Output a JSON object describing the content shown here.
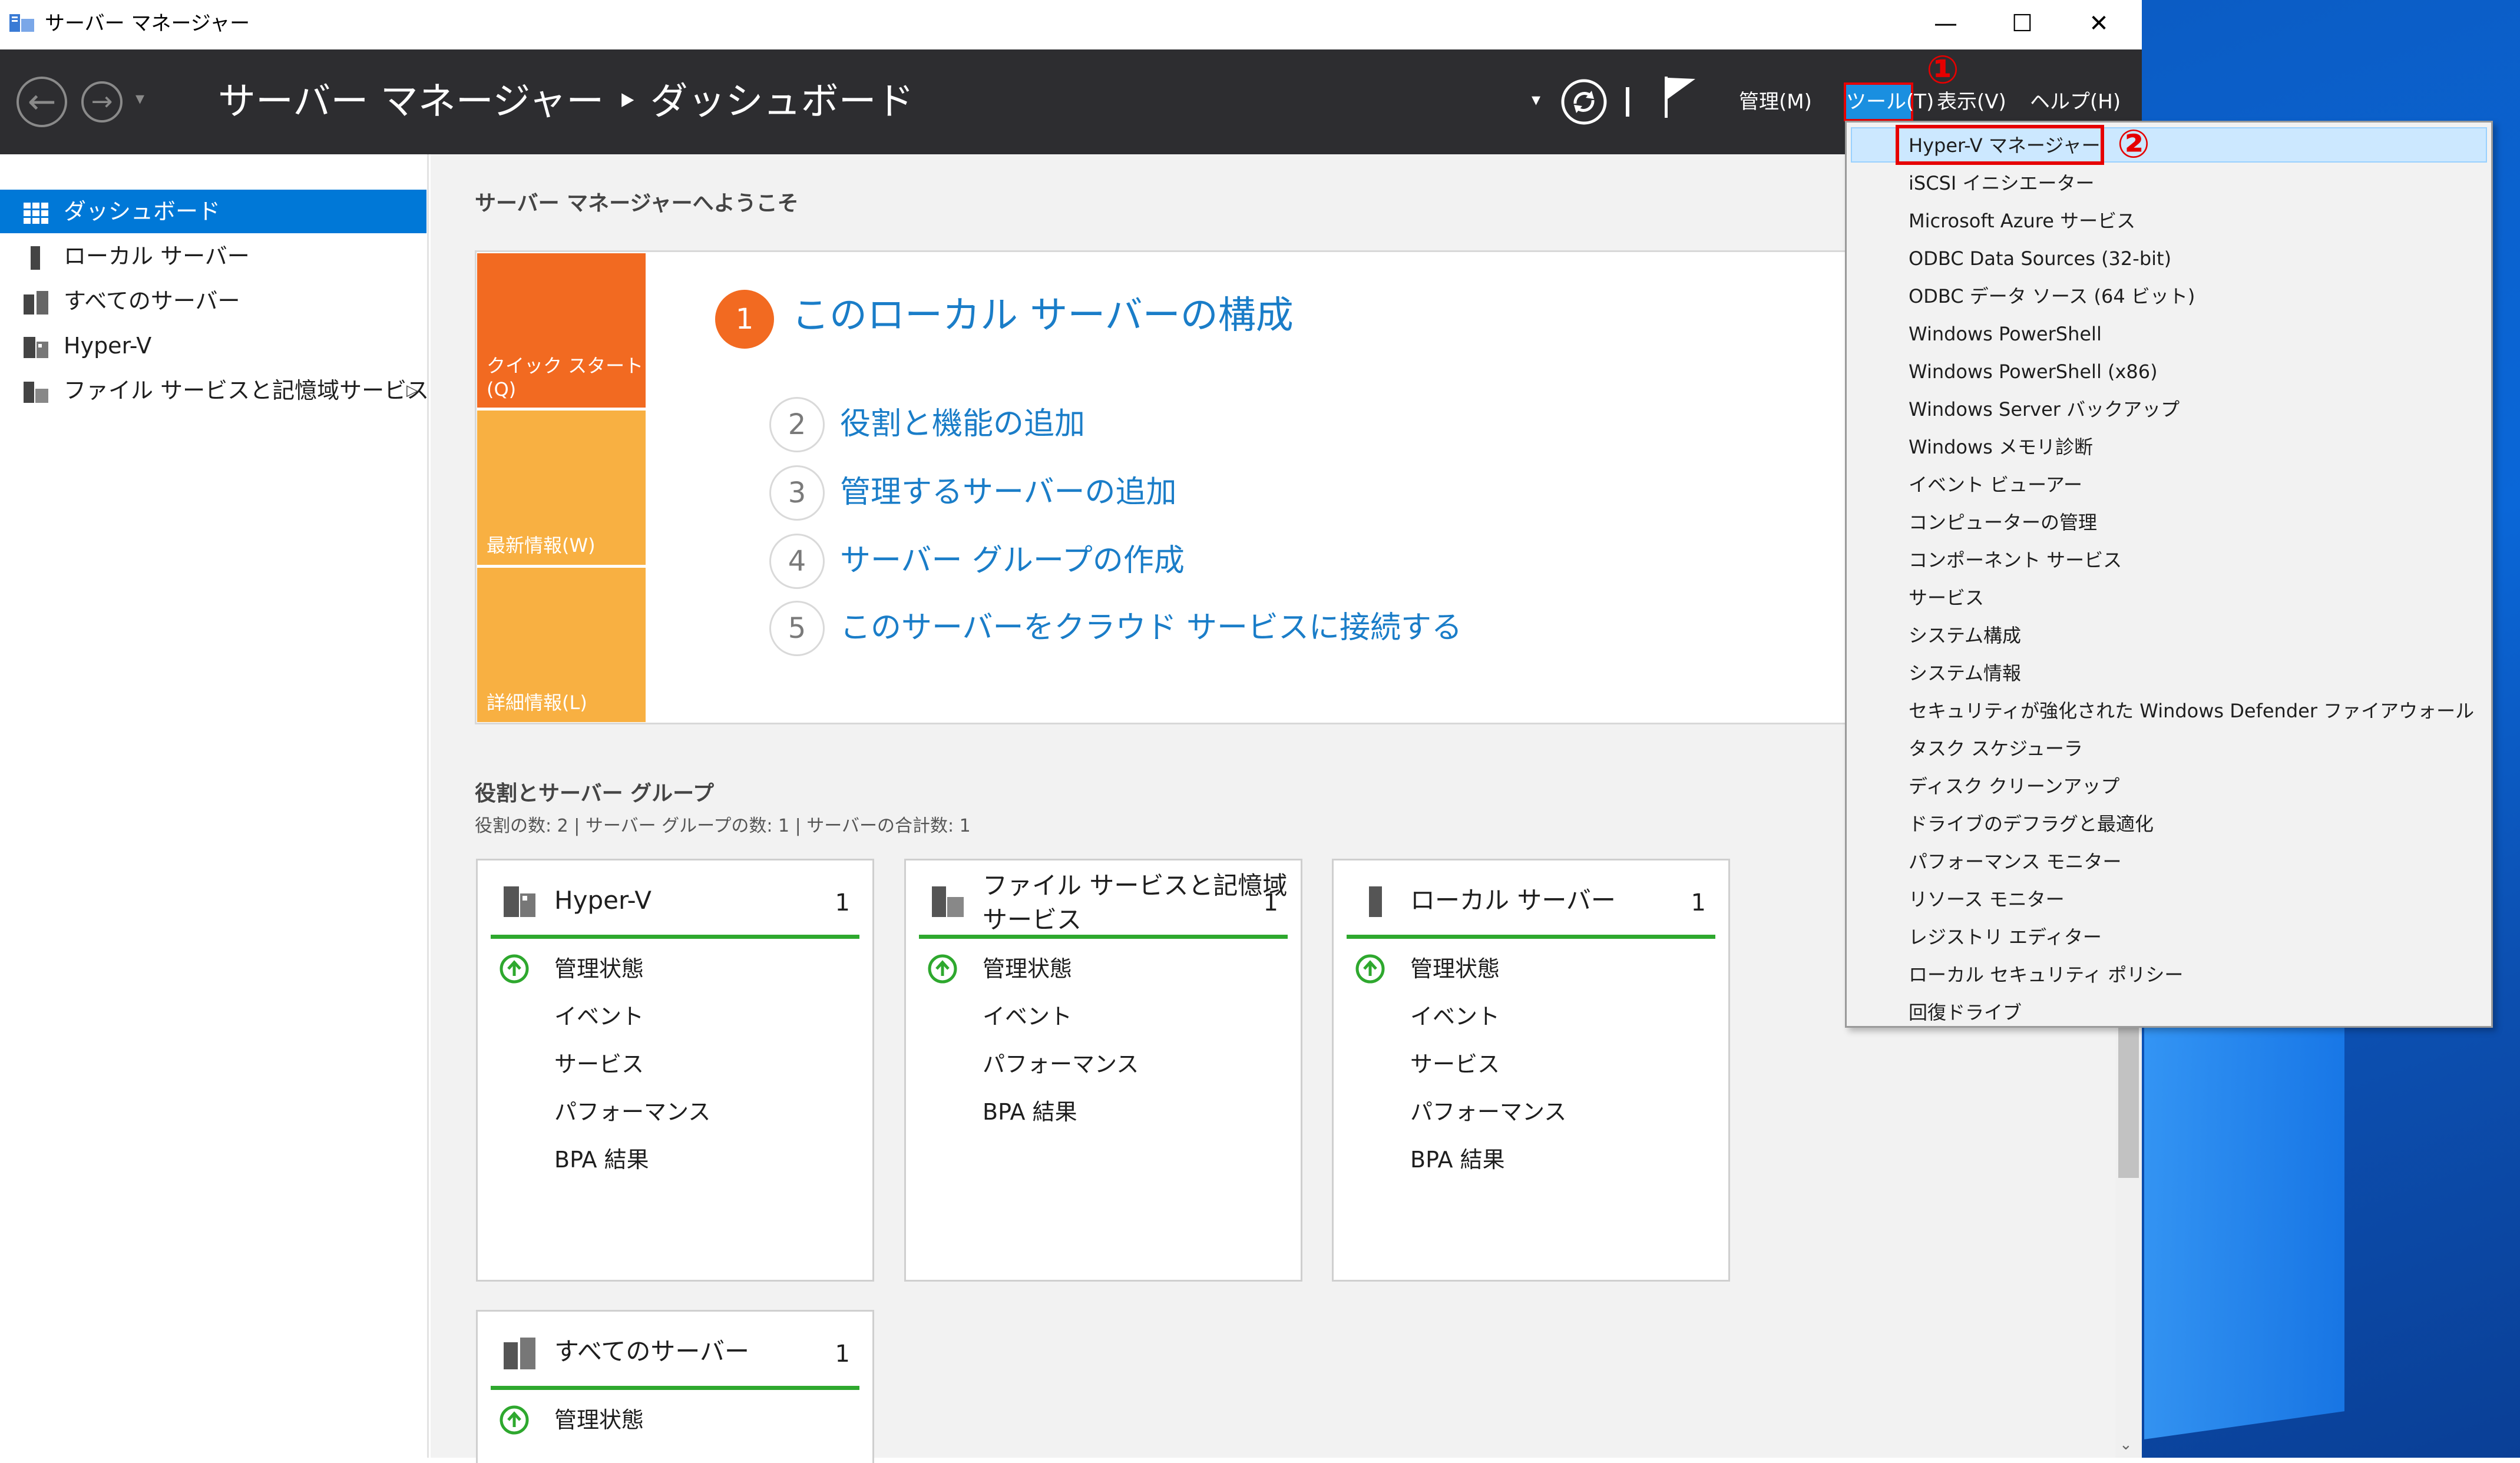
{
  "window": {
    "title": "サーバー マネージャー",
    "controls": [
      "—",
      "☐",
      "✕"
    ]
  },
  "header": {
    "breadcrumb": "サーバー マネージャー ‣ ダッシュボード",
    "menus": {
      "manage": "管理(M)",
      "tools": "ツール(T)",
      "view": "表示(V)",
      "help": "ヘルプ(H)"
    },
    "annotation1": "①",
    "annotation2": "②"
  },
  "sidebar": {
    "items": [
      {
        "label": "ダッシュボード",
        "active": true
      },
      {
        "label": "ローカル サーバー"
      },
      {
        "label": "すべてのサーバー"
      },
      {
        "label": "Hyper-V"
      },
      {
        "label": "ファイル サービスと記憶域サービス"
      }
    ]
  },
  "main": {
    "welcome": "サーバー マネージャーへようこそ",
    "tiles": [
      "クイック スタート(Q)",
      "最新情報(W)",
      "詳細情報(L)"
    ],
    "steps": [
      {
        "num": "1",
        "label": "このローカル サーバーの構成"
      },
      {
        "num": "2",
        "label": "役割と機能の追加"
      },
      {
        "num": "3",
        "label": "管理するサーバーの追加"
      },
      {
        "num": "4",
        "label": "サーバー グループの作成"
      },
      {
        "num": "5",
        "label": "このサーバーをクラウド サービスに接続する"
      }
    ],
    "roles_title": "役割とサーバー グループ",
    "roles_summary": "役割の数: 2 | サーバー グループの数: 1 | サーバーの合計数: 1",
    "cards": [
      {
        "title": "Hyper-V",
        "count": "1",
        "rows": [
          "管理状態",
          "イベント",
          "サービス",
          "パフォーマンス",
          "BPA 結果"
        ]
      },
      {
        "title": "ファイル サービスと記憶域\nサービス",
        "count": "1",
        "rows": [
          "管理状態",
          "イベント",
          "パフォーマンス",
          "BPA 結果"
        ]
      },
      {
        "title": "ローカル サーバー",
        "count": "1",
        "rows": [
          "管理状態",
          "イベント",
          "サービス",
          "パフォーマンス",
          "BPA 結果"
        ]
      },
      {
        "title": "すべてのサーバー",
        "count": "1",
        "rows": [
          "管理状態"
        ]
      }
    ]
  },
  "tools_dropdown": {
    "items": [
      "Hyper-V マネージャー",
      "iSCSI イニシエーター",
      "Microsoft Azure サービス",
      "ODBC Data Sources (32-bit)",
      "ODBC データ ソース (64 ビット)",
      "Windows PowerShell",
      "Windows PowerShell (x86)",
      "Windows Server バックアップ",
      "Windows メモリ診断",
      "イベント ビューアー",
      "コンピューターの管理",
      "コンポーネント サービス",
      "サービス",
      "システム構成",
      "システム情報",
      "セキュリティが強化された Windows Defender ファイアウォール",
      "タスク スケジューラ",
      "ディスク クリーンアップ",
      "ドライブのデフラグと最適化",
      "パフォーマンス モニター",
      "リソース モニター",
      "レジストリ エディター",
      "ローカル セキュリティ ポリシー",
      "回復ドライブ"
    ]
  }
}
